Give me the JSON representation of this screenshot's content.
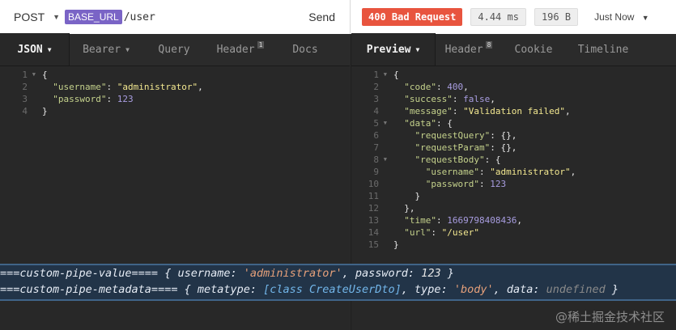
{
  "request": {
    "method": "POST",
    "env_tag": "BASE_URL",
    "path": "/user",
    "send_label": "Send"
  },
  "response": {
    "status": "400 Bad Request",
    "time": "4.44 ms",
    "size": "196 B",
    "timestamp": "Just Now"
  },
  "left_tabs": [
    {
      "label": "JSON"
    },
    {
      "label": "Bearer"
    },
    {
      "label": "Query"
    },
    {
      "label": "Header",
      "count": "1"
    },
    {
      "label": "Docs"
    }
  ],
  "right_tabs": [
    {
      "label": "Preview"
    },
    {
      "label": "Header",
      "count": "8"
    },
    {
      "label": "Cookie"
    },
    {
      "label": "Timeline"
    }
  ],
  "request_body": {
    "line_numbers": [
      "1",
      "2",
      "3",
      "4"
    ],
    "username_key": "\"username\"",
    "username_value": "\"administrator\"",
    "password_key": "\"password\"",
    "password_value": "123"
  },
  "response_body": {
    "line_numbers": [
      "1",
      "2",
      "3",
      "4",
      "5",
      "6",
      "7",
      "8",
      "9",
      "10",
      "11",
      "12",
      "13",
      "14",
      "15"
    ],
    "code_key": "\"code\"",
    "code_value": "400",
    "success_key": "\"success\"",
    "success_value": "false",
    "message_key": "\"message\"",
    "message_value": "\"Validation failed\"",
    "data_key": "\"data\"",
    "request_query_key": "\"requestQuery\"",
    "request_param_key": "\"requestParam\"",
    "request_body_key": "\"requestBody\"",
    "username_key": "\"username\"",
    "username_value": "\"administrator\"",
    "password_key": "\"password\"",
    "password_value": "123",
    "time_key": "\"time\"",
    "time_value": "1669798408436",
    "url_key": "\"url\"",
    "url_value": "\"/user\""
  },
  "terminal": {
    "line1_prefix": "===custom-pipe-value==== { username: ",
    "line1_username": "'administrator'",
    "line1_mid": ", password: ",
    "line1_password": "123",
    "line1_suffix": " }",
    "line2_prefix": "===custom-pipe-metadata==== { metatype: ",
    "line2_class": "[class CreateUserDto]",
    "line2_mid": ", type: ",
    "line2_type": "'body'",
    "line2_mid2": ", data: ",
    "line2_data": "undefined",
    "line2_suffix": " }"
  },
  "watermark": "@稀土掘金技术社区"
}
